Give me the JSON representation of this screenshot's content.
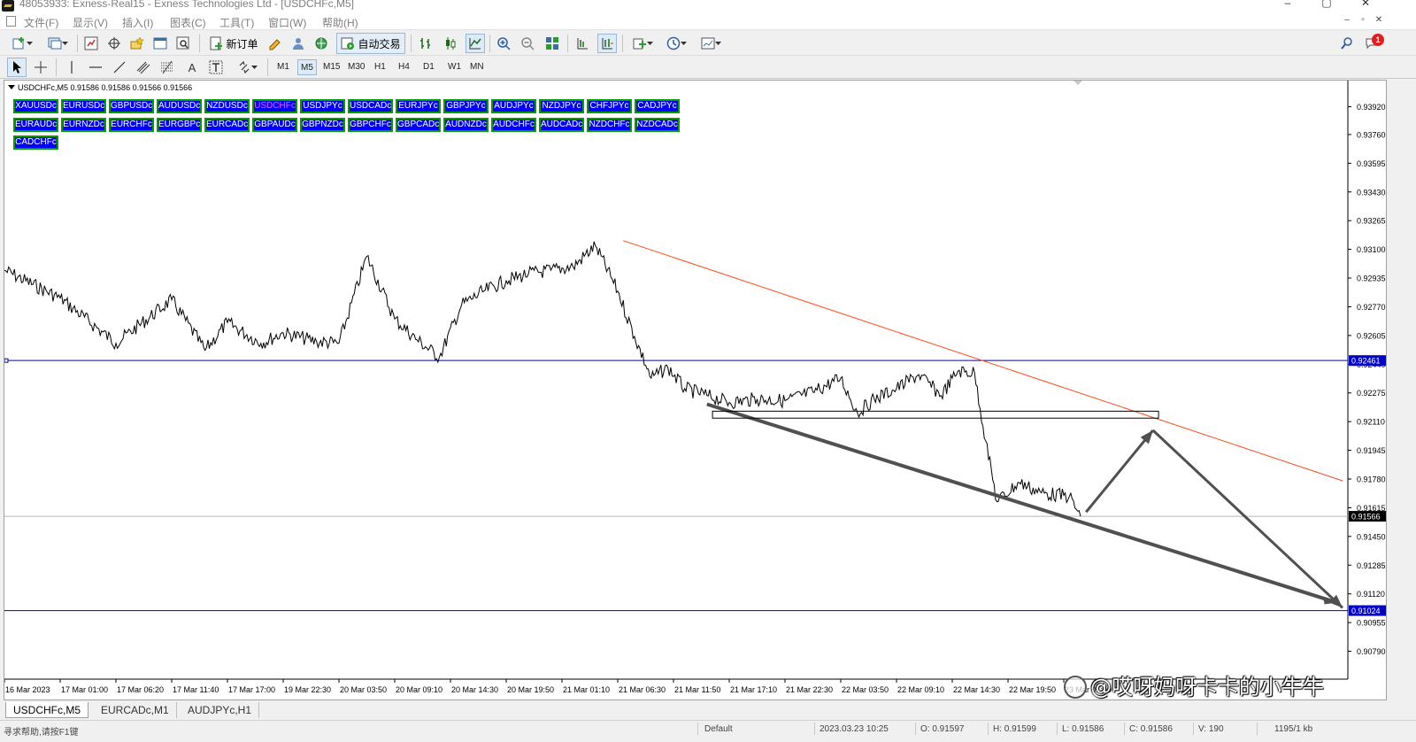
{
  "window": {
    "title": "48053933: Exness-Real15 - Exness Technologies Ltd - [USDCHFc,M5]",
    "controls": [
      "–",
      "▢",
      "✕"
    ]
  },
  "menu": {
    "items": [
      "文件(F)",
      "显示(V)",
      "插入(I)",
      "图表(C)",
      "工具(T)",
      "窗口(W)",
      "帮助(H)"
    ],
    "mdi_controls": [
      "–",
      "▫",
      "✕"
    ]
  },
  "toolbar": {
    "new_order_label": "新订单",
    "auto_trade_label": "自动交易",
    "timeframes": [
      "M1",
      "M5",
      "M15",
      "M30",
      "H1",
      "H4",
      "D1",
      "W1",
      "MN"
    ],
    "active_timeframe": "M5",
    "notification_count": "1"
  },
  "chart": {
    "header": "USDCHFc,M5  0.91586 0.91586 0.91566 0.91566",
    "symbol_buttons_row1": [
      "XAUUSDc",
      "EURUSDc",
      "GBPUSDc",
      "AUDUSDc",
      "NZDUSDc",
      "USDCHFc",
      "USDJPYc",
      "USDCADc",
      "EURJPYc",
      "GBPJPYc",
      "AUDJPYc",
      "NZDJPYc",
      "CHFJPYc",
      "CADJPYc"
    ],
    "symbol_buttons_row2": [
      "EURAUDc",
      "EURNZDc",
      "EURCHFc",
      "EURGBPc",
      "EURCADc",
      "GBPAUDc",
      "GBPNZDc",
      "GBPCHFc",
      "GBPCADc",
      "AUDNZDc",
      "AUDCHFc",
      "AUDCADc",
      "NZDCHFc",
      "NZDCADc"
    ],
    "symbol_buttons_row3": [
      "CADCHFc"
    ],
    "active_symbol": "USDCHFc",
    "price_line_labels": {
      "upper": "0.92461",
      "current": "0.91566",
      "lower": "0.91024"
    },
    "colors": {
      "symbol_button_bg": "#0000ff",
      "symbol_button_border": "#00a000",
      "active_symbol_text": "#ff55ff",
      "hline": "#0000c8",
      "trendline": "#ff4a1a",
      "arrow": "#505050",
      "price_line": "#000000"
    }
  },
  "chart_data": {
    "type": "line",
    "title": "USDCHFc,M5",
    "xlabel": "",
    "ylabel": "",
    "ylim": [
      0.9063,
      0.9407
    ],
    "y_ticks": [
      "0.93920",
      "0.93760",
      "0.93595",
      "0.93430",
      "0.93265",
      "0.93100",
      "0.92935",
      "0.92770",
      "0.92605",
      "0.92440",
      "0.92275",
      "0.92110",
      "0.91945",
      "0.91780",
      "0.91615",
      "0.91450",
      "0.91285",
      "0.91120",
      "0.90955",
      "0.90790"
    ],
    "x_tick_labels": [
      "16 Mar 2023",
      "17 Mar 01:00",
      "17 Mar 06:20",
      "17 Mar 11:40",
      "17 Mar 17:00",
      "19 Mar 22:30",
      "20 Mar 03:50",
      "20 Mar 09:10",
      "20 Mar 14:30",
      "20 Mar 19:50",
      "21 Mar 01:10",
      "21 Mar 06:30",
      "21 Mar 11:50",
      "21 Mar 17:10",
      "21 Mar 22:30",
      "22 Mar 03:50",
      "22 Mar 09:10",
      "22 Mar 14:30",
      "22 Mar 19:50",
      "23 Mar 01:10"
    ],
    "series": [
      {
        "name": "USDCHFc",
        "x": [
          0,
          1,
          2,
          3,
          3.6,
          4,
          4.6,
          5,
          5.6,
          6,
          6.5,
          7,
          7.4,
          7.8,
          8.2,
          8.6,
          9,
          9.4,
          9.8,
          10.2,
          10.6,
          11,
          11.3,
          11.6,
          11.9,
          12.2,
          12.6,
          13,
          13.5,
          14,
          14.5,
          15,
          15.3,
          15.6,
          16,
          16.4,
          16.8,
          17.1,
          17.4,
          17.6,
          17.8,
          18.2,
          18.6,
          19.1,
          19.3
        ],
        "y": [
          0.9298,
          0.9282,
          0.9256,
          0.9281,
          0.9252,
          0.9268,
          0.9256,
          0.9262,
          0.9257,
          0.9256,
          0.9306,
          0.927,
          0.9258,
          0.9248,
          0.9278,
          0.9286,
          0.9292,
          0.9296,
          0.9298,
          0.93,
          0.9312,
          0.9286,
          0.926,
          0.9236,
          0.9242,
          0.923,
          0.9226,
          0.9222,
          0.9224,
          0.9223,
          0.9228,
          0.9236,
          0.9216,
          0.9224,
          0.923,
          0.9238,
          0.9226,
          0.924,
          0.9239,
          0.92,
          0.9165,
          0.9176,
          0.917,
          0.9168,
          0.91566
        ]
      }
    ],
    "horizontal_lines": [
      0.92461,
      0.91024
    ],
    "current_price": 0.91566,
    "trendlines": [
      {
        "from": [
          11.1,
          0.9315
        ],
        "to": [
          24.0,
          0.9177
        ],
        "color": "#ff4a1a"
      },
      {
        "from": [
          12.6,
          0.9221
        ],
        "to": [
          23.9,
          0.9107
        ],
        "color": "#505050"
      }
    ],
    "rectangle": {
      "from": [
        12.7,
        0.9217
      ],
      "to": [
        20.7,
        0.9213
      ]
    },
    "arrows": [
      {
        "from": [
          19.4,
          0.9159
        ],
        "to": [
          20.6,
          0.9206
        ]
      },
      {
        "from": [
          20.6,
          0.9206
        ],
        "to": [
          24.0,
          0.9104
        ]
      }
    ],
    "grid": false,
    "legend": "none"
  },
  "tabs": [
    "USDCHFc,M5",
    "EURCADc,M1",
    "AUDJPYc,H1"
  ],
  "status": {
    "help": "寻求帮助,请按F1键",
    "profile": "Default",
    "datetime": "2023.03.23 10:25",
    "open": "O: 0.91597",
    "high": "H: 0.91599",
    "low": "L: 0.91586",
    "close": "C: 0.91586",
    "volume": "V: 190",
    "traffic": "1195/1 kb"
  },
  "watermark": "@哎呀妈呀卡卡的小牛牛"
}
